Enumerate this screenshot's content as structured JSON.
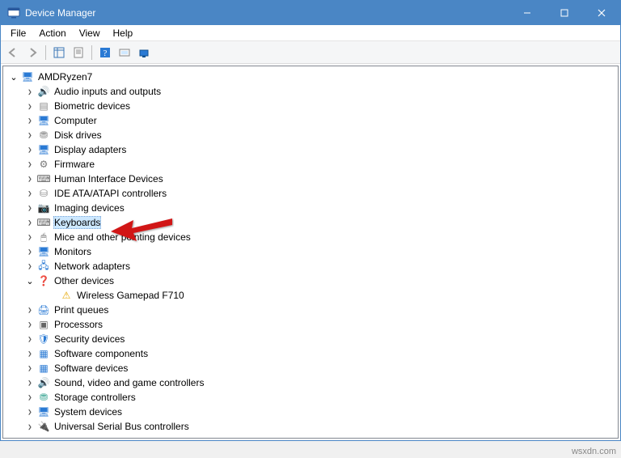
{
  "window": {
    "title": "Device Manager"
  },
  "menu": {
    "file": "File",
    "action": "Action",
    "view": "View",
    "help": "Help"
  },
  "toolbar_icons": [
    "back",
    "forward",
    "_sep",
    "up-folder",
    "properties",
    "_sep",
    "help",
    "legacy",
    "monitor"
  ],
  "root": {
    "label": "AMDRyzen7",
    "expanded": true
  },
  "nodes": [
    {
      "id": "audio",
      "label": "Audio inputs and outputs",
      "color": "#4a6",
      "glyph": "🔊"
    },
    {
      "id": "biometric",
      "label": "Biometric devices",
      "color": "#888",
      "glyph": "▤"
    },
    {
      "id": "computer",
      "label": "Computer",
      "color": "#2a7ad4",
      "glyph": "🖥"
    },
    {
      "id": "diskdrives",
      "label": "Disk drives",
      "color": "#888",
      "glyph": "⛃"
    },
    {
      "id": "display",
      "label": "Display adapters",
      "color": "#2a7ad4",
      "glyph": "🖥"
    },
    {
      "id": "firmware",
      "label": "Firmware",
      "color": "#777",
      "glyph": "⚙"
    },
    {
      "id": "hid",
      "label": "Human Interface Devices",
      "color": "#666",
      "glyph": "⌨"
    },
    {
      "id": "ide",
      "label": "IDE ATA/ATAPI controllers",
      "color": "#888",
      "glyph": "⛁"
    },
    {
      "id": "imaging",
      "label": "Imaging devices",
      "color": "#888",
      "glyph": "📷"
    },
    {
      "id": "keyboards",
      "label": "Keyboards",
      "color": "#666",
      "glyph": "⌨",
      "selected": true
    },
    {
      "id": "mice",
      "label": "Mice and other pointing devices",
      "color": "#666",
      "glyph": "🖱"
    },
    {
      "id": "monitors",
      "label": "Monitors",
      "color": "#2a7ad4",
      "glyph": "🖥"
    },
    {
      "id": "network",
      "label": "Network adapters",
      "color": "#2a7ad4",
      "glyph": "🖧"
    },
    {
      "id": "other",
      "label": "Other devices",
      "color": "#e6a700",
      "glyph": "❓",
      "expanded": true,
      "children": [
        {
          "id": "wgp",
          "label": "Wireless Gamepad F710",
          "color": "#e6a700",
          "glyph": "⚠"
        }
      ]
    },
    {
      "id": "printq",
      "label": "Print queues",
      "color": "#2a7ad4",
      "glyph": "🖨"
    },
    {
      "id": "processors",
      "label": "Processors",
      "color": "#666",
      "glyph": "▣"
    },
    {
      "id": "security",
      "label": "Security devices",
      "color": "#2a7ad4",
      "glyph": "🛡"
    },
    {
      "id": "swcomp",
      "label": "Software components",
      "color": "#2a7ad4",
      "glyph": "▦"
    },
    {
      "id": "swdev",
      "label": "Software devices",
      "color": "#2a7ad4",
      "glyph": "▦"
    },
    {
      "id": "sound",
      "label": "Sound, video and game controllers",
      "color": "#4a6",
      "glyph": "🔊"
    },
    {
      "id": "storage",
      "label": "Storage controllers",
      "color": "#4a9",
      "glyph": "⛃"
    },
    {
      "id": "system",
      "label": "System devices",
      "color": "#2a7ad4",
      "glyph": "🖥"
    },
    {
      "id": "usb",
      "label": "Universal Serial Bus controllers",
      "color": "#666",
      "glyph": "🔌"
    }
  ],
  "watermark": "wsxdn.com"
}
